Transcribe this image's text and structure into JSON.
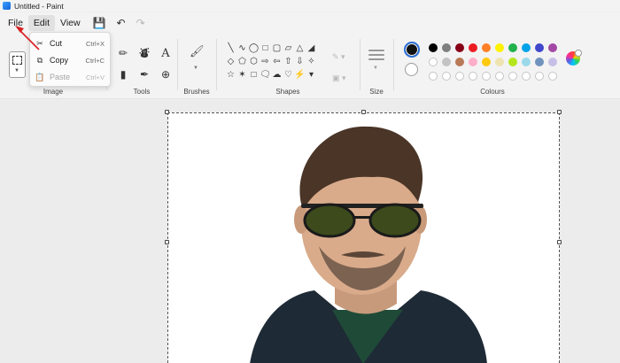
{
  "window": {
    "title": "Untitled - Paint"
  },
  "menu": {
    "file": "File",
    "edit": "Edit",
    "view": "View"
  },
  "quick_access": {
    "save_icon": "save-icon",
    "undo_icon": "undo-icon",
    "redo_icon": "redo-icon"
  },
  "edit_menu": {
    "items": [
      {
        "label": "Cut",
        "shortcut": "Ctrl+X",
        "icon": "scissors-icon",
        "enabled": true
      },
      {
        "label": "Copy",
        "shortcut": "Ctrl+C",
        "icon": "copy-icon",
        "enabled": true
      },
      {
        "label": "Paste",
        "shortcut": "Ctrl+V",
        "icon": "paste-icon",
        "enabled": false
      }
    ]
  },
  "ribbon": {
    "groups": {
      "image": "Image",
      "tools": "Tools",
      "brushes": "Brushes",
      "shapes": "Shapes",
      "size": "Size",
      "colours": "Colours"
    }
  },
  "colours": {
    "primary": "#000000",
    "secondary": "#ffffff",
    "palette_row1": [
      "#000000",
      "#7f7f7f",
      "#880015",
      "#ed1c24",
      "#ff7f27",
      "#fff200",
      "#22b14c",
      "#00a2e8",
      "#3f48cc",
      "#a349a4"
    ],
    "palette_row2": [
      "#ffffff",
      "#c3c3c3",
      "#b97a57",
      "#ffaec9",
      "#ffc90e",
      "#efe4b0",
      "#b5e61d",
      "#99d9ea",
      "#7092be",
      "#c8bfe7"
    ]
  },
  "canvas": {
    "image": "portrait-photo",
    "annotation": "red-arrow-pointing-to-file-menu"
  }
}
